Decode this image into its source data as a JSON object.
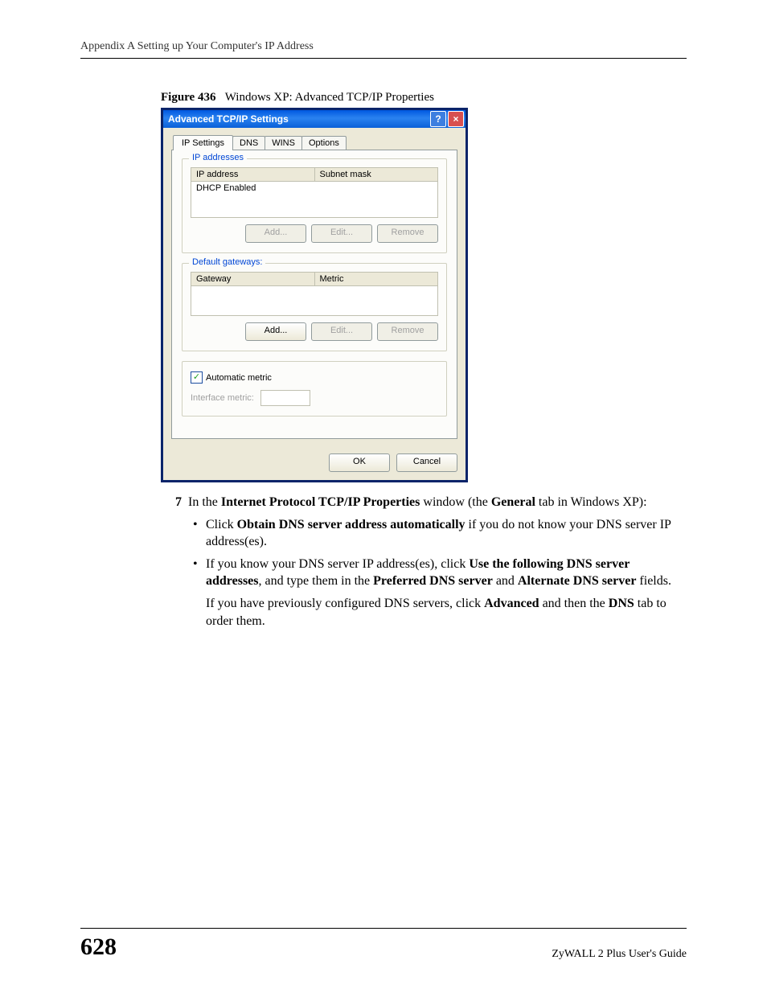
{
  "header": {
    "appendix": "Appendix A Setting up Your Computer's IP Address"
  },
  "figure": {
    "label": "Figure 436",
    "caption": "Windows XP: Advanced TCP/IP Properties"
  },
  "dialog": {
    "title": "Advanced TCP/IP Settings",
    "help_icon": "?",
    "close_icon": "×",
    "tabs": {
      "ip_settings": "IP Settings",
      "dns": "DNS",
      "wins": "WINS",
      "options": "Options"
    },
    "group_ip": {
      "legend": "IP addresses",
      "col1": "IP address",
      "col2": "Subnet mask",
      "row1": "DHCP Enabled",
      "add": "Add...",
      "edit": "Edit...",
      "remove": "Remove"
    },
    "group_gw": {
      "legend": "Default gateways:",
      "col1": "Gateway",
      "col2": "Metric",
      "add": "Add...",
      "edit": "Edit...",
      "remove": "Remove"
    },
    "auto_metric": {
      "check": "✓",
      "label": "Automatic metric",
      "iface_label": "Interface metric:"
    },
    "footer": {
      "ok": "OK",
      "cancel": "Cancel"
    }
  },
  "step": {
    "num": "7",
    "text_pre": "In the ",
    "bold1": "Internet Protocol TCP/IP Properties",
    "text_mid": " window (the ",
    "bold2": "General",
    "text_post": " tab in Windows XP):"
  },
  "bullets": {
    "b1": {
      "pre": "Click ",
      "bold": "Obtain DNS server address automatically",
      "post": " if you do not know your DNS server IP address(es)."
    },
    "b2": {
      "pre": "If you know your DNS server IP address(es), click ",
      "bold1": "Use the following DNS server addresses",
      "mid1": ", and type them in the ",
      "bold2": "Preferred DNS server",
      "mid2": " and ",
      "bold3": "Alternate DNS server",
      "post": " fields."
    },
    "b2b": {
      "pre": "If you have previously configured DNS servers, click ",
      "bold1": "Advanced",
      "mid": " and then the ",
      "bold2": "DNS",
      "post": " tab to order them."
    }
  },
  "footer": {
    "page": "628",
    "guide": "ZyWALL 2 Plus User's Guide"
  }
}
